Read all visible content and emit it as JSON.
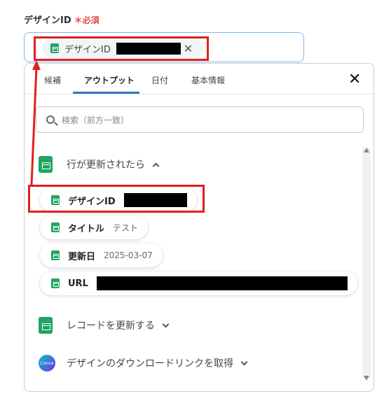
{
  "field": {
    "label": "デザインID",
    "required_mark": "＊必須",
    "chip_label": "デザインID",
    "clear_icon": "close-icon"
  },
  "panel": {
    "tabs": [
      "候補",
      "アウトプット",
      "日付",
      "基本情報"
    ],
    "active_tab": "アウトプット",
    "search_placeholder": "検索（前方一致）"
  },
  "groups": [
    {
      "title": "行が更新されたら",
      "icon": "google-sheets-icon",
      "expanded": true
    },
    {
      "title": "レコードを更新する",
      "icon": "google-sheets-icon",
      "expanded": false
    },
    {
      "title": "デザインのダウンロードリンクを取得",
      "icon": "canva-icon",
      "expanded": false
    }
  ],
  "outputs": [
    {
      "key": "デザインID",
      "value": "",
      "redacted": true
    },
    {
      "key": "タイトル",
      "value": "テスト"
    },
    {
      "key": "更新日",
      "value": "2025-03-07"
    },
    {
      "key": "URL",
      "value": "",
      "redacted": true
    }
  ],
  "canva_logo_text": "Canva",
  "colors": {
    "accent": "#2f78c4",
    "sheets": "#1fa463",
    "highlight": "#e02020",
    "required": "#e5484d"
  }
}
